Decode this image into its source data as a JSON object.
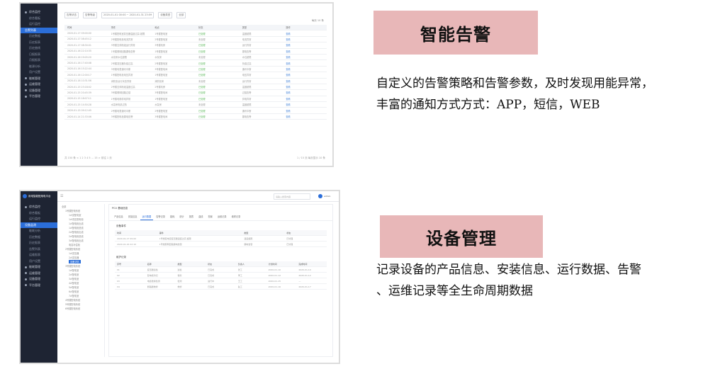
{
  "top_screenshot": {
    "sidebar": [
      {
        "label": "综合监控",
        "kind": "group"
      },
      {
        "label": "综合看板",
        "kind": "sub"
      },
      {
        "label": "运行监控",
        "kind": "sub"
      },
      {
        "label": "告警列表",
        "kind": "active"
      },
      {
        "label": "历史数据",
        "kind": "sub"
      },
      {
        "label": "历史报表",
        "kind": "sub"
      },
      {
        "label": "历史曲线",
        "kind": "sub"
      },
      {
        "label": "日报报表",
        "kind": "sub"
      },
      {
        "label": "月报报表",
        "kind": "sub"
      },
      {
        "label": "能源分析",
        "kind": "sub"
      },
      {
        "label": "用户设置",
        "kind": "sub"
      },
      {
        "label": "能耗管理",
        "kind": "group"
      },
      {
        "label": "运维管理",
        "kind": "group"
      },
      {
        "label": "设备管理",
        "kind": "group"
      },
      {
        "label": "平台管理",
        "kind": "group"
      }
    ],
    "filters": [
      "告警状态",
      "告警等级",
      "2020-01-01 00:00 ~ 2020-01-31 23:59",
      "设备类型",
      "全部"
    ],
    "pager_top": "每页 10 条",
    "columns": [
      "时间",
      "事件",
      "地点",
      "状态",
      "类型",
      "操作"
    ],
    "rows": [
      [
        "2020-01-17 09:00:00",
        "1号楼配电室变压器温度过高 超限",
        "1号楼配电室",
        "已处理",
        "温度超限",
        "查看"
      ],
      [
        "2020-01-17 08:45:12",
        "2号楼配电柜电流异常",
        "2号楼配电室",
        "未处理",
        "电流异常",
        "查看"
      ],
      [
        "2020-01-17 08:30:01",
        "3号楼空调机组运行异常",
        "3号楼机房",
        "已处理",
        "运行异常",
        "查看"
      ],
      [
        "2020-01-16 22:10:35",
        "1号楼照明回路漏电告警",
        "1号楼配电室",
        "已处理",
        "漏电告警",
        "查看"
      ],
      [
        "2020-01-16 19:05:20",
        "水泵房水位超限",
        "水泵房",
        "未处理",
        "水位超限",
        "查看"
      ],
      [
        "2020-01-16 17:40:08",
        "2号楼变压器负载过高",
        "2号楼配电室",
        "已处理",
        "负载过高",
        "查看"
      ],
      [
        "2020-01-16 15:22:44",
        "3号楼电表通讯中断",
        "3号楼配电间",
        "已处理",
        "通讯中断",
        "查看"
      ],
      [
        "2020-01-16 12:00:17",
        "1号楼配电柜电压异常",
        "1号楼配电室",
        "已处理",
        "电压异常",
        "查看"
      ],
      [
        "2020-01-16 10:31:56",
        "消防泵运行状态异常",
        "消防泵房",
        "未处理",
        "运行异常",
        "查看"
      ],
      [
        "2020-01-15 23:18:02",
        "2号楼空调机组温度过高",
        "2号楼机房",
        "已处理",
        "温度超限",
        "查看"
      ],
      [
        "2020-01-15 20:45:39",
        "3号楼照明回路过载",
        "3号楼配电间",
        "已处理",
        "过载告警",
        "查看"
      ],
      [
        "2020-01-15 18:07:11",
        "1号楼电梯供电异常",
        "1号楼配电室",
        "已处理",
        "供电异常",
        "查看"
      ],
      [
        "2020-01-15 14:50:28",
        "水泵房电机过热",
        "水泵房",
        "未处理",
        "温度超限",
        "查看"
      ],
      [
        "2020-01-15 09:12:45",
        "2号楼电表通讯中断",
        "2号楼配电室",
        "已处理",
        "通讯中断",
        "查看"
      ],
      [
        "2020-01-14 21:33:06",
        "3号楼配电柜漏电告警",
        "3号楼配电间",
        "已处理",
        "漏电告警",
        "查看"
      ]
    ],
    "pager_bottom_left": "共 150 条  < 1 2 3 4 5 ... 15 >  前往 1 页",
    "pager_bottom_right": "1 / 15 页  每页显示 10 条"
  },
  "bottom_screenshot": {
    "brand": "用电智能配用电平台",
    "search_placeholder": "请输入搜索内容",
    "user": "admin",
    "sidebar": [
      {
        "label": "综合监控",
        "kind": "group"
      },
      {
        "label": "综合看板",
        "kind": "sub"
      },
      {
        "label": "运行监控",
        "kind": "sub"
      },
      {
        "label": "设备监测",
        "kind": "active"
      },
      {
        "label": "能耗分析",
        "kind": "sub"
      },
      {
        "label": "历史数据",
        "kind": "sub"
      },
      {
        "label": "历史报表",
        "kind": "sub"
      },
      {
        "label": "告警列表",
        "kind": "sub"
      },
      {
        "label": "运维报表",
        "kind": "sub"
      },
      {
        "label": "用户设置",
        "kind": "sub"
      },
      {
        "label": "能耗管理",
        "kind": "group"
      },
      {
        "label": "运维管理",
        "kind": "group"
      },
      {
        "label": "设备管理",
        "kind": "group"
      },
      {
        "label": "平台管理",
        "kind": "group"
      }
    ],
    "tree": [
      "全部",
      "1号楼配电系统",
      "1#变配电室",
      "1#低压配电柜",
      "1#配电柜出线",
      "1#配电柜进线",
      "2#配电柜出线",
      "2#配电柜进线",
      "3#配电柜出线",
      "电容补偿柜",
      "2号楼配电系统",
      "1#变压器",
      "2#变压器",
      "设备详情",
      "3号楼配电系统",
      "1#配电室",
      "2#配电室",
      "3#配电室",
      "4#配电室",
      "5#配电室",
      "6#配电室",
      "7#配电室",
      "4号楼配电系统",
      "5号楼配电系统",
      "6号楼配电系统"
    ],
    "tree_selected": 13,
    "panel_title": "PCU 基础信息",
    "tabs": [
      "产品信息",
      "安装信息",
      "运行数据",
      "告警记录",
      "能耗",
      "统计",
      "报表",
      "曲线",
      "档案",
      "运维记录",
      "维修记录"
    ],
    "active_tab": 2,
    "section1_title": "设备事件",
    "table1_columns": [
      "时间",
      "事件",
      "",
      "类型",
      "状态"
    ],
    "table1_rows": [
      [
        "2020-01-17 09:00",
        "1号楼配电室变压器温度过高 超限",
        "",
        "温度超限",
        "已处理"
      ],
      [
        "2020-01-16 22:10",
        "1号楼照明回路漏电告警",
        "",
        "漏电告警",
        "已处理"
      ]
    ],
    "section2_title": "维护记录",
    "table2_columns": [
      "序号",
      "名称",
      "类型",
      "状态",
      "负责人",
      "计划时间",
      "完成时间"
    ],
    "table2_rows": [
      [
        "01",
        "变压器巡检",
        "巡检",
        "已完成",
        "张工",
        "2020-01-10",
        "2020-01-10"
      ],
      [
        "02",
        "配电柜清扫",
        "保养",
        "已完成",
        "李工",
        "2020-01-12",
        "2020-01-12"
      ],
      [
        "03",
        "电缆绝缘检测",
        "检测",
        "进行中",
        "王工",
        "2020-01-15",
        "—"
      ],
      [
        "04",
        "断路器维修",
        "维修",
        "已完成",
        "赵工",
        "2020-01-16",
        "2020-01-17"
      ]
    ]
  },
  "cards": [
    {
      "title": "智能告警",
      "lines": [
        "自定义的告警策略和告警参数，及时发现用能异常，",
        "丰富的通知方式方式：APP，短信，WEB"
      ]
    },
    {
      "title": "设备管理",
      "lines": [
        "记录设备的产品信息、安装信息、运行数据、告警",
        "、运维记录等全生命周期数据"
      ]
    }
  ]
}
